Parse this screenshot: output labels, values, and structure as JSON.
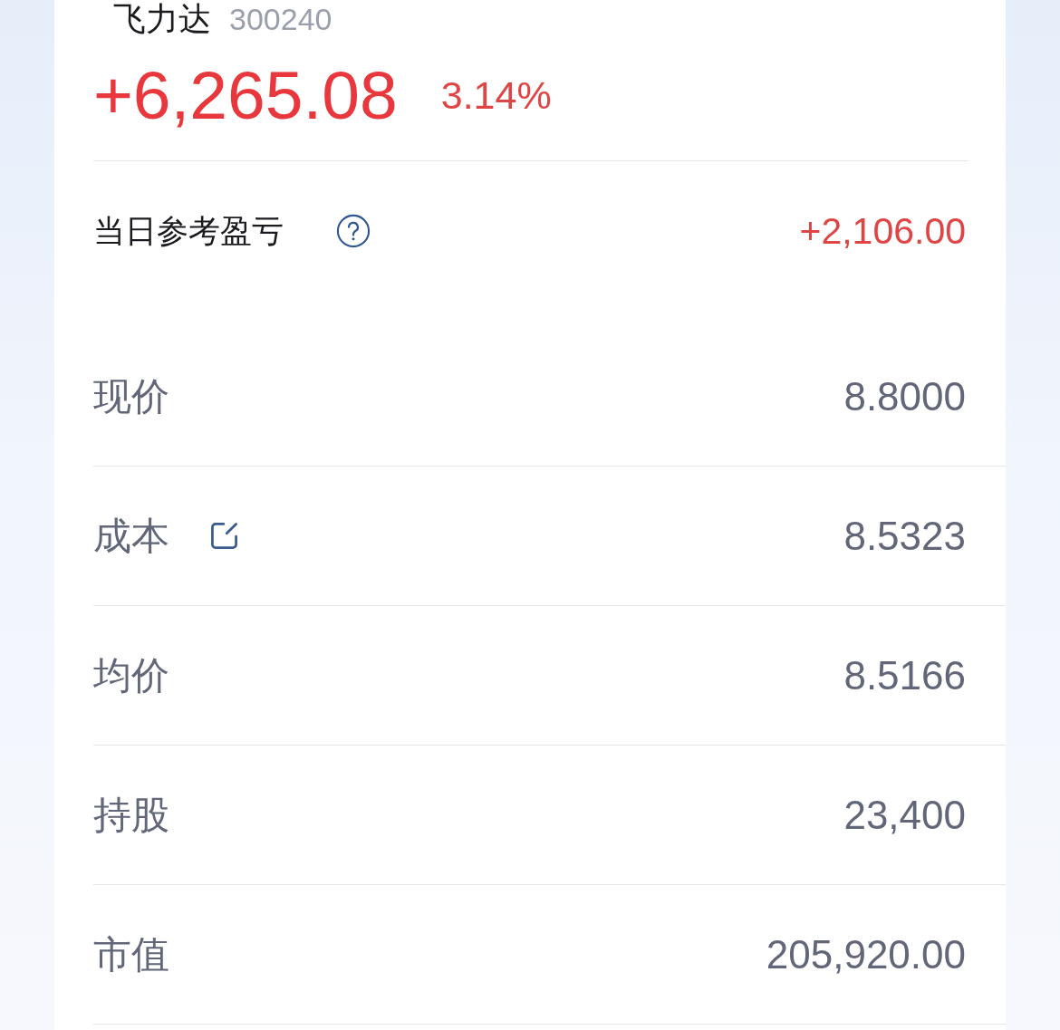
{
  "stock": {
    "name": "飞力达",
    "code": "300240"
  },
  "profit": {
    "amount": "+6,265.08",
    "percent": "3.14%"
  },
  "daily_pnl": {
    "label": "当日参考盈亏",
    "value": "+2,106.00"
  },
  "details": [
    {
      "label": "现价",
      "value": "8.8000",
      "editable": false
    },
    {
      "label": "成本",
      "value": "8.5323",
      "editable": true
    },
    {
      "label": "均价",
      "value": "8.5166",
      "editable": false
    },
    {
      "label": "持股",
      "value": "23,400",
      "editable": false
    },
    {
      "label": "市值",
      "value": "205,920.00",
      "editable": false
    }
  ]
}
